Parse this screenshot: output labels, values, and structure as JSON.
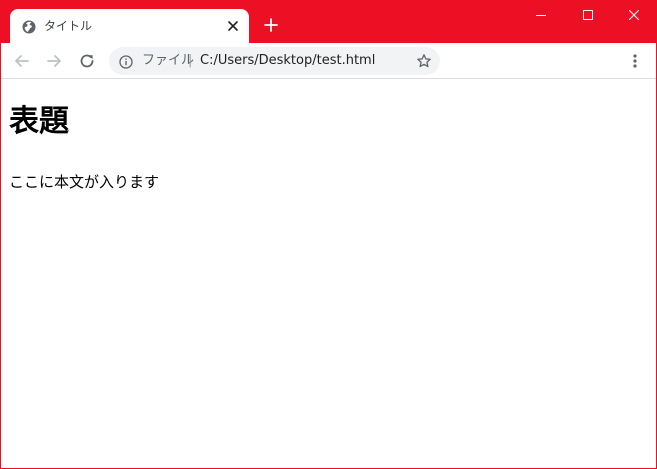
{
  "browser": {
    "tab": {
      "title": "タイトル",
      "favicon": "globe-icon"
    },
    "address_bar": {
      "scheme_label": "ファイル",
      "separator": "|",
      "url": "C:/Users/Desktop/test.html"
    },
    "icons": {
      "back": "arrow-left-icon",
      "forward": "arrow-right-icon",
      "reload": "reload-icon",
      "info": "info-icon",
      "bookmark": "star-icon",
      "menu": "kebab-menu-icon",
      "new_tab": "plus-icon",
      "tab_close": "close-icon",
      "minimize": "minimize-icon",
      "maximize": "maximize-icon",
      "window_close": "close-icon"
    },
    "colors": {
      "frame": "#ed1024",
      "omnibox": "#f1f3f4",
      "content_background": "#ffffff"
    }
  },
  "page": {
    "heading": "表題",
    "body": "ここに本文が入ります"
  }
}
